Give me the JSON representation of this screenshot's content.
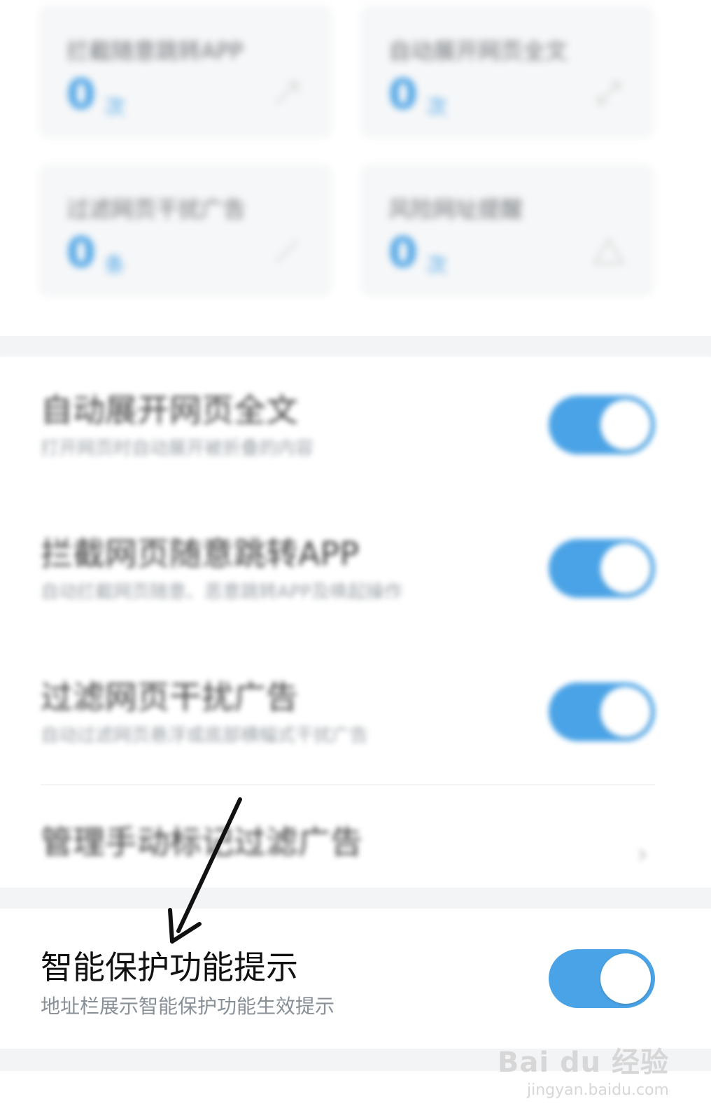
{
  "stats": [
    {
      "title": "拦截随意跳转APP",
      "value": "0",
      "unit": "次",
      "icon": "share-icon"
    },
    {
      "title": "自动展开网页全文",
      "value": "0",
      "unit": "次",
      "icon": "expand-icon"
    },
    {
      "title": "过滤网页干扰广告",
      "value": "0",
      "unit": "条",
      "icon": "filter-icon"
    },
    {
      "title": "风险网址提醒",
      "value": "0",
      "unit": "次",
      "icon": "warning-icon"
    }
  ],
  "settings": [
    {
      "title": "自动展开网页全文",
      "subtitle": "打开网页时自动展开被折叠的内容",
      "enabled": true
    },
    {
      "title": "拦截网页随意跳转APP",
      "subtitle": "自动拦截网页随意、恶意跳转APP及唤起操作",
      "enabled": true
    },
    {
      "title": "过滤网页干扰广告",
      "subtitle": "自动过滤网页悬浮或底部横幅式干扰广告",
      "enabled": true
    }
  ],
  "manage_row": {
    "title": "管理手动标记过滤广告"
  },
  "smart_row": {
    "title": "智能保护功能提示",
    "subtitle": "地址栏展示智能保护功能生效提示",
    "enabled": true
  },
  "watermark": {
    "brand": "Bai du 经验",
    "url": "jingyan.baidu.com"
  },
  "colors": {
    "accent": "#4aa3e6",
    "background": "#ffffff",
    "separator": "#f3f4f6"
  }
}
